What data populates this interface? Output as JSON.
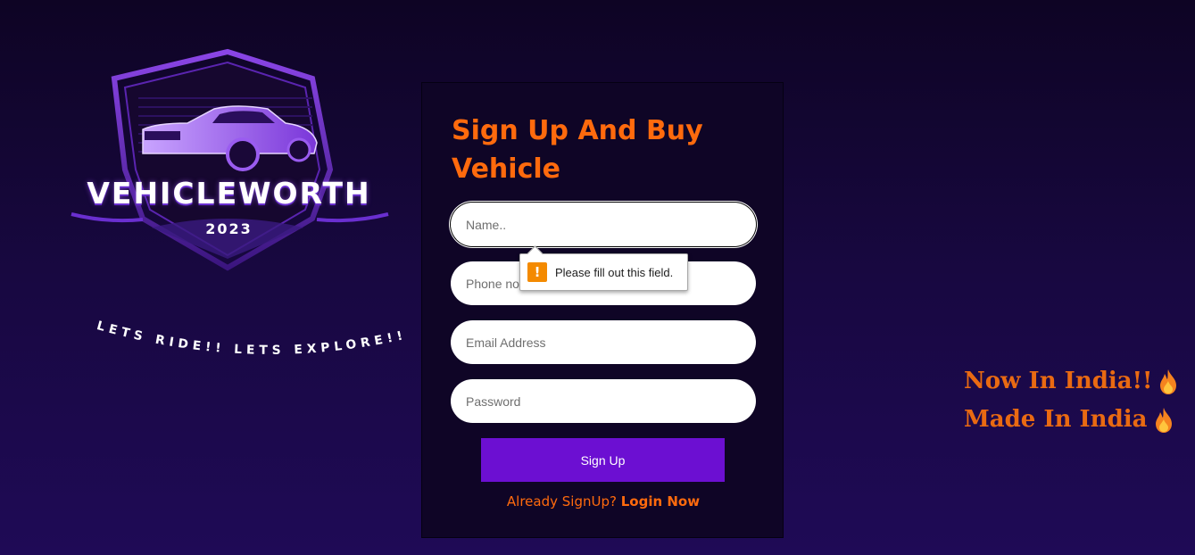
{
  "logo": {
    "brand": "VEHICLEWORTH",
    "year": "2023",
    "tagline": "LETS RIDE!! LETS EXPLORE!!"
  },
  "form": {
    "title": "Sign Up And Buy Vehicle",
    "fields": {
      "name_placeholder": "Name..",
      "phone_placeholder": "Phone no",
      "email_placeholder": "Email Address",
      "password_placeholder": "Password"
    },
    "submit_label": "Sign Up",
    "login_prompt": "Already SignUp?",
    "login_link": "Login Now"
  },
  "tooltip": {
    "icon": "warning-icon",
    "message": "Please fill out this field."
  },
  "promo": {
    "line1": "Now In India!!",
    "line2": "Made In India",
    "icon": "fire-icon"
  },
  "colors": {
    "accent_orange": "#ff6a0d",
    "button_purple": "#6c0fd2",
    "background_dark": "#180841",
    "warning_orange": "#f48a00"
  }
}
